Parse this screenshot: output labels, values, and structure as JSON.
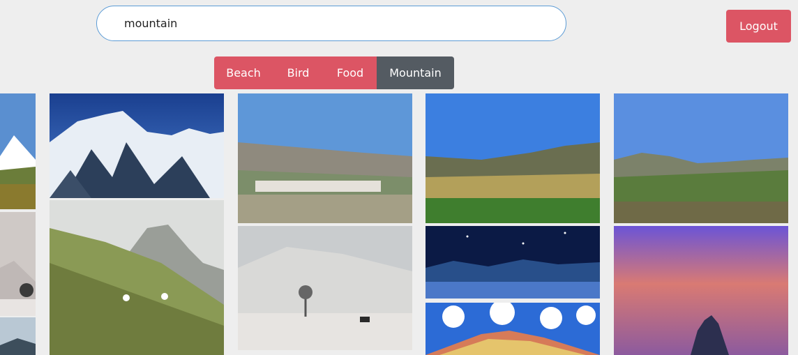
{
  "search": {
    "value": "mountain"
  },
  "header": {
    "logout_label": "Logout"
  },
  "filters": [
    {
      "label": "Beach",
      "active": false
    },
    {
      "label": "Bird",
      "active": false
    },
    {
      "label": "Food",
      "active": false
    },
    {
      "label": "Mountain",
      "active": true
    }
  ],
  "colors": {
    "accent": "#dc5564",
    "active_filter": "#545b62",
    "search_border": "#5b9bd5",
    "background": "#eeeeee"
  }
}
